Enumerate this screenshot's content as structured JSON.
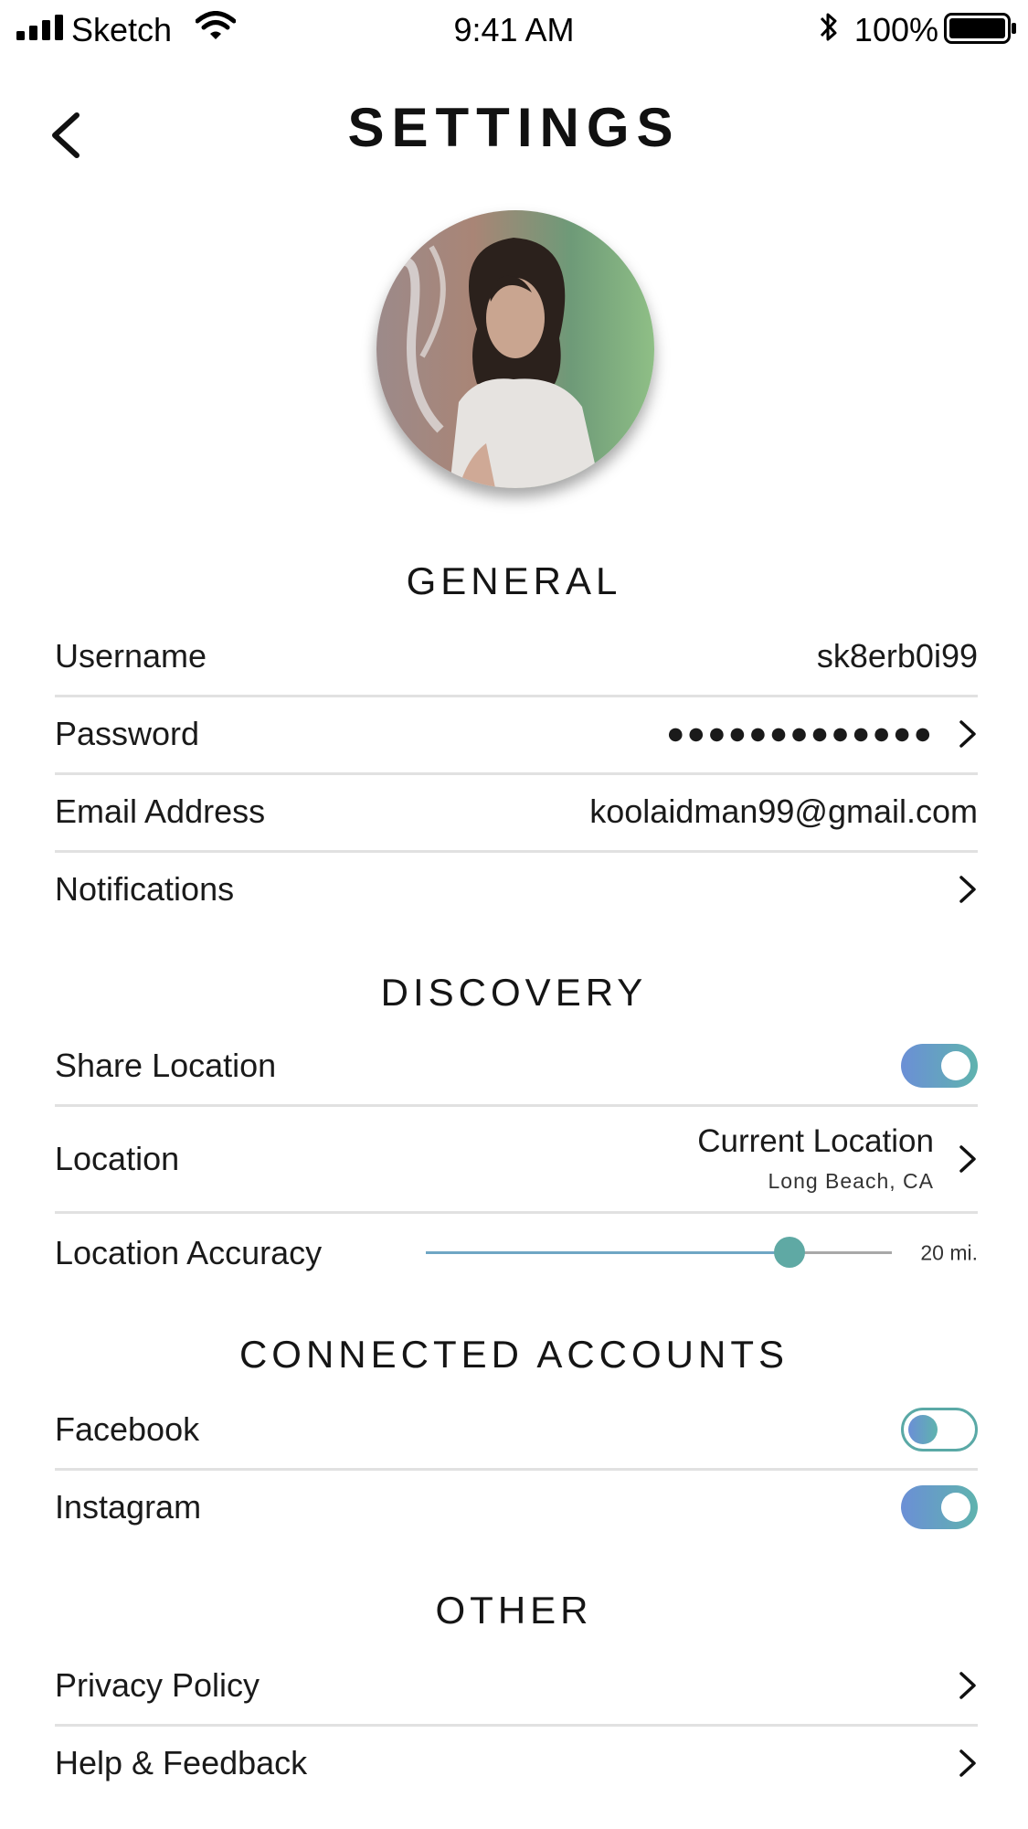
{
  "status_bar": {
    "carrier": "Sketch",
    "time": "9:41 AM",
    "battery": "100%",
    "icons": [
      "signal-icon",
      "wifi-icon",
      "bluetooth-icon",
      "battery-icon"
    ]
  },
  "header": {
    "title": "SETTINGS",
    "back_icon": "chevron-left-icon"
  },
  "sections": {
    "general": {
      "title": "GENERAL",
      "username_label": "Username",
      "username_value": "sk8erb0i99",
      "password_label": "Password",
      "password_value": "●●●●●●●●●●●●●",
      "email_label": "Email Address",
      "email_value": "koolaidman99@gmail.com",
      "notifications_label": "Notifications"
    },
    "discovery": {
      "title": "DISCOVERY",
      "share_location_label": "Share Location",
      "share_location_on": true,
      "location_label": "Location",
      "location_value": "Current Location",
      "location_sub": "Long Beach, CA",
      "accuracy_label": "Location Accuracy",
      "accuracy_value": "20 mi.",
      "accuracy_fraction": 0.78
    },
    "connected_accounts": {
      "title": "CONNECTED ACCOUNTS",
      "facebook_label": "Facebook",
      "facebook_on": false,
      "instagram_label": "Instagram",
      "instagram_on": true
    },
    "other": {
      "title": "OTHER",
      "privacy_label": "Privacy Policy",
      "help_label": "Help & Feedback"
    }
  },
  "colors": {
    "accent_start": "#6b8fd6",
    "accent_end": "#5fb3ae",
    "divider": "#e1e1e1"
  }
}
